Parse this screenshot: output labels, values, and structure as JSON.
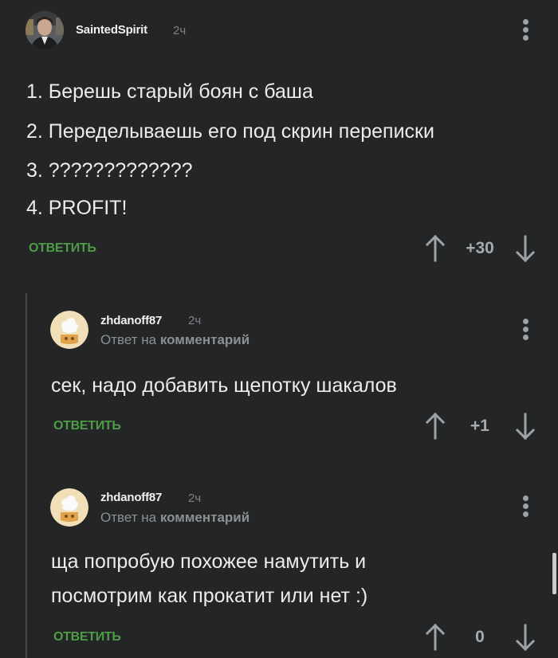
{
  "comments": [
    {
      "username": "SaintedSpirit",
      "time": "2ч",
      "lines": [
        "1. Берешь старый боян с баша",
        "2. Переделываешь его под скрин переписки",
        "3. ?????????????",
        "4. PROFIT!"
      ],
      "reply_label": "ОТВЕТИТЬ",
      "rating": "+30"
    },
    {
      "username": "zhdanoff87",
      "time": "2ч",
      "reply_to_prefix": "Ответ на",
      "reply_to_link": "комментарий",
      "lines": [
        "сек, надо добавить щепотку шакалов"
      ],
      "reply_label": "ОТВЕТИТЬ",
      "rating": "+1"
    },
    {
      "username": "zhdanoff87",
      "time": "2ч",
      "reply_to_prefix": "Ответ на",
      "reply_to_link": "комментарий",
      "lines": [
        "ща попробую похожее намутить и",
        "посмотрим как прокатит или нет :)"
      ],
      "reply_label": "ОТВЕТИТЬ",
      "rating": "0"
    }
  ],
  "icons": {
    "more": "more-vertical-icon",
    "up": "arrow-up-icon",
    "down": "arrow-down-icon"
  },
  "colors": {
    "background": "#232526",
    "accent_green": "#4f9c46",
    "text": "#ececec",
    "muted": "#8c9092"
  }
}
